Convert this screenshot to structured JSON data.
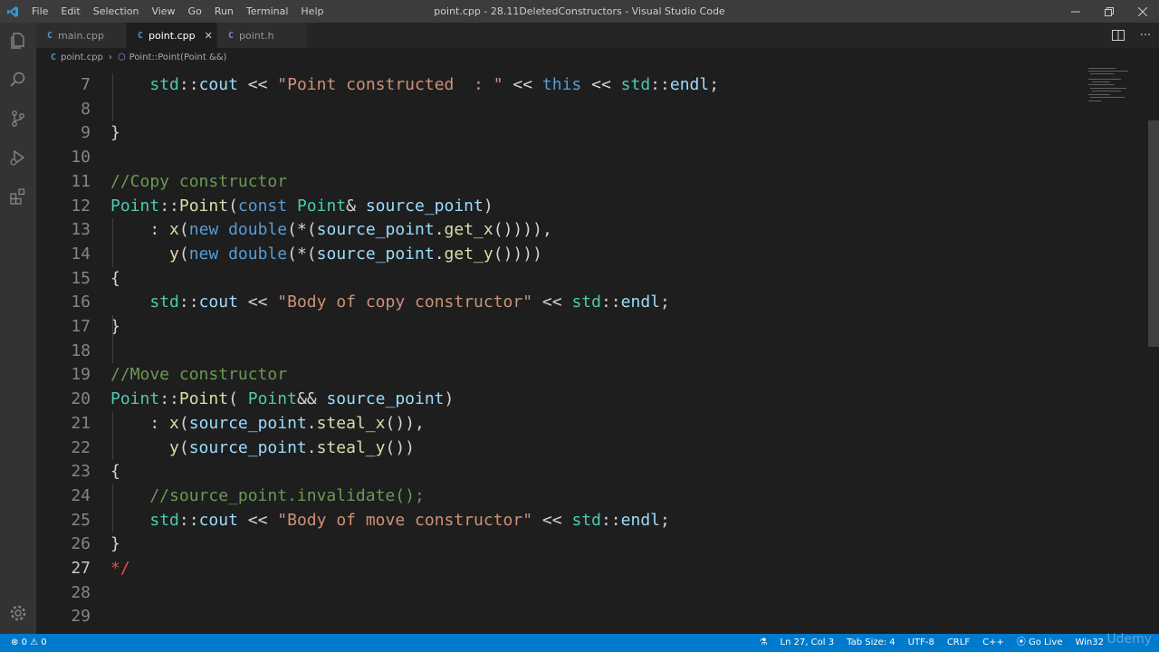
{
  "menu": [
    "File",
    "Edit",
    "Selection",
    "View",
    "Go",
    "Run",
    "Terminal",
    "Help"
  ],
  "window_title": "point.cpp - 28.11DeletedConstructors - Visual Studio Code",
  "tabs": [
    {
      "icon": "C",
      "label": "main.cpp"
    },
    {
      "icon": "C",
      "label": "point.cpp"
    },
    {
      "icon": "C",
      "label": "point.h"
    }
  ],
  "breadcrumb": {
    "file": "point.cpp",
    "symbol": "Point::Point(Point &&)"
  },
  "editor": {
    "lines": [
      {
        "num": "7",
        "text": "    std::cout << \"Point constructed  : \" << this << std::endl;"
      },
      {
        "num": "8",
        "text": ""
      },
      {
        "num": "9",
        "text": "}"
      },
      {
        "num": "10",
        "text": ""
      },
      {
        "num": "11",
        "text": "//Copy constructor"
      },
      {
        "num": "12",
        "text": "Point::Point(const Point& source_point)"
      },
      {
        "num": "13",
        "text": "    : x(new double(*(source_point.get_x()))),"
      },
      {
        "num": "14",
        "text": "      y(new double(*(source_point.get_y())))"
      },
      {
        "num": "15",
        "text": "{"
      },
      {
        "num": "16",
        "text": "    std::cout << \"Body of copy constructor\" << std::endl;"
      },
      {
        "num": "17",
        "text": "}"
      },
      {
        "num": "18",
        "text": ""
      },
      {
        "num": "19",
        "text": "//Move constructor"
      },
      {
        "num": "20",
        "text": "Point::Point( Point&& source_point)"
      },
      {
        "num": "21",
        "text": "    : x(source_point.steal_x()),"
      },
      {
        "num": "22",
        "text": "      y(source_point.steal_y())"
      },
      {
        "num": "23",
        "text": "{"
      },
      {
        "num": "24",
        "text": "    //source_point.invalidate();"
      },
      {
        "num": "25",
        "text": "    std::cout << \"Body of move constructor\" << std::endl;"
      },
      {
        "num": "26",
        "text": "}"
      },
      {
        "num": "27",
        "text": "*/"
      },
      {
        "num": "28",
        "text": ""
      },
      {
        "num": "29",
        "text": ""
      }
    ],
    "current_line": "27"
  },
  "status": {
    "errors": "0",
    "warnings": "0",
    "position": "Ln 27, Col 3",
    "tab_size": "Tab Size: 4",
    "encoding": "UTF-8",
    "eol": "CRLF",
    "language": "C++",
    "go_live": "Go Live",
    "platform": "Win32"
  },
  "watermark": "Udemy",
  "colors": {
    "accent": "#007acc",
    "keyword": "#569cd6",
    "function": "#dcdcaa",
    "type": "#4ec9b0",
    "string": "#ce9178",
    "comment": "#6a9955",
    "variable": "#9cdcfe"
  }
}
